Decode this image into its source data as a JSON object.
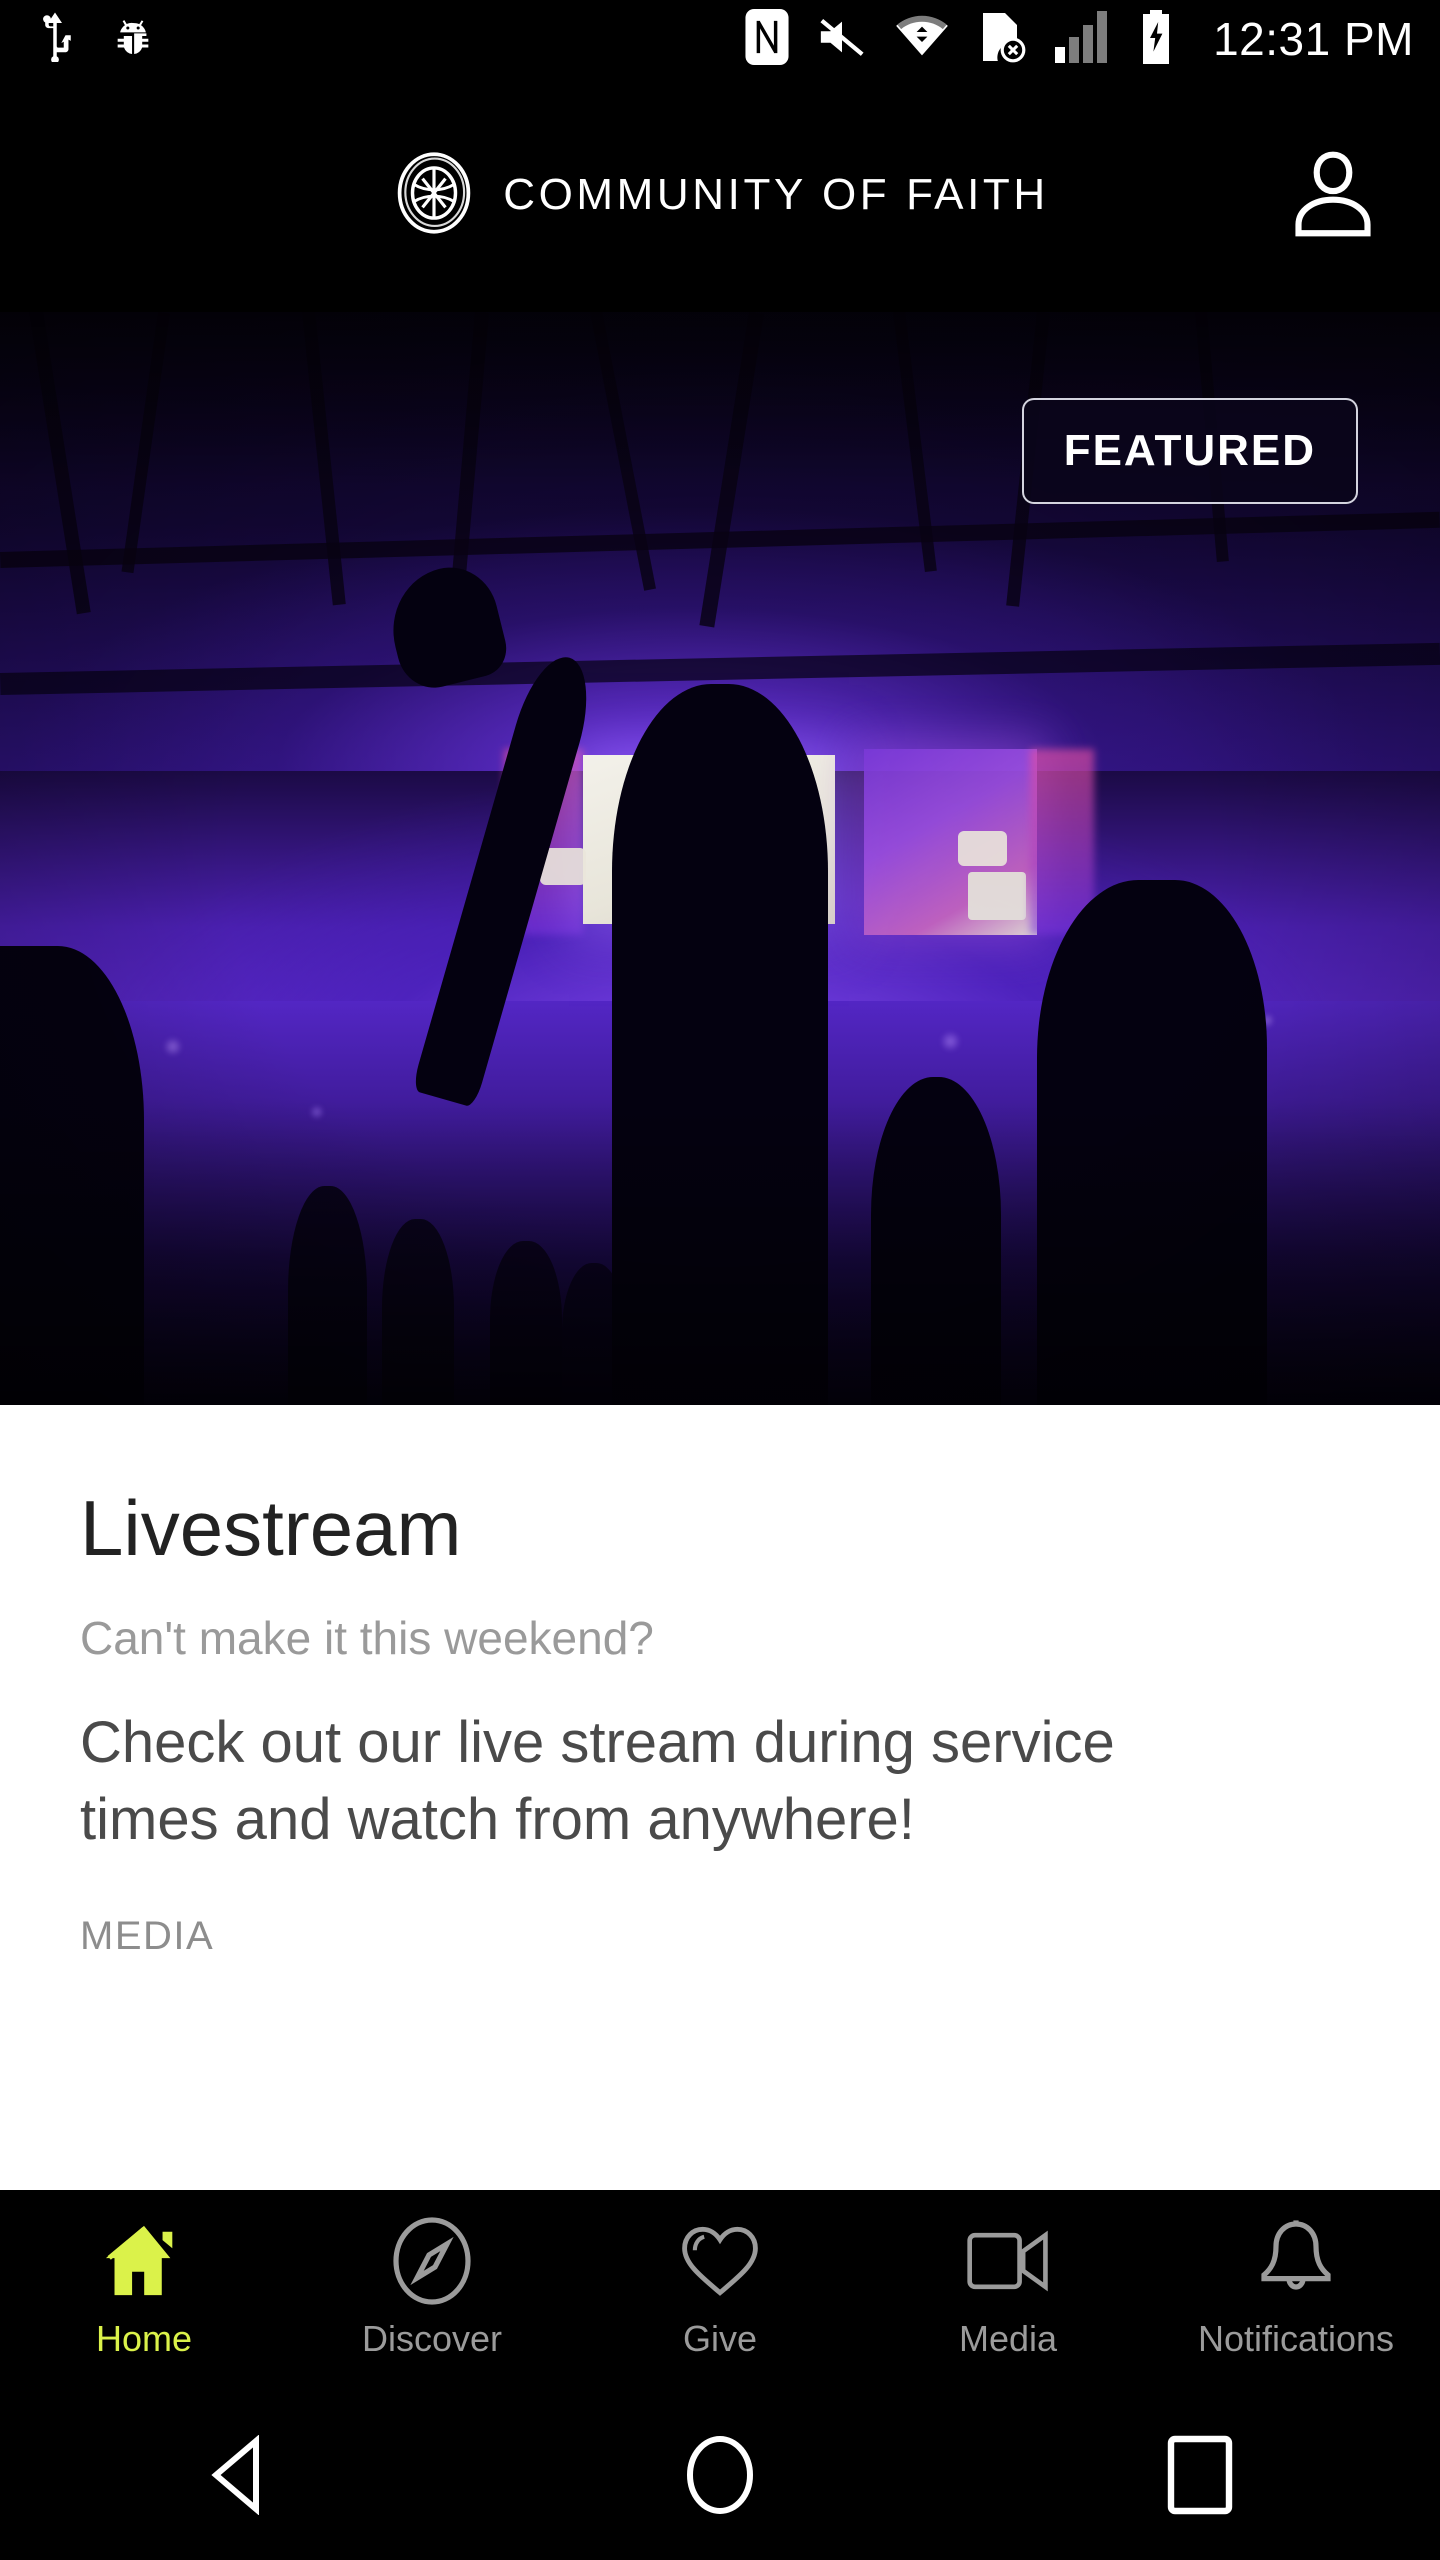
{
  "status_bar": {
    "left_icons": [
      {
        "name": "usb-icon",
        "label": "USB connected"
      },
      {
        "name": "android-debug-icon",
        "label": "USB debugging"
      }
    ],
    "right_icons": [
      {
        "name": "nfc-icon",
        "label": "NFC"
      },
      {
        "name": "volume-mute-icon",
        "label": "Sound off"
      },
      {
        "name": "wifi-icon",
        "label": "Wi-Fi"
      },
      {
        "name": "no-sim-icon",
        "label": "No SIM"
      },
      {
        "name": "signal-bars-icon",
        "label": "Cellular signal"
      },
      {
        "name": "battery-charging-icon",
        "label": "Battery charging"
      }
    ],
    "time": "12:31 PM"
  },
  "header": {
    "logo_name": "globe-cross-logo",
    "title": "COMMUNITY OF FAITH",
    "profile_icon": "person-icon"
  },
  "hero": {
    "badge": "FEATURED",
    "image_description": "Worship service auditorium with purple stage lighting, video screens and silhouetted crowd with raised hand"
  },
  "card": {
    "title": "Livestream",
    "subtitle": "Can't make it this weekend?",
    "body": "Check out our live stream during service times and watch from anywhere!",
    "category": "MEDIA"
  },
  "bottom_nav": {
    "active_color": "#dbf24a",
    "inactive_color": "#9b9b9b",
    "items": [
      {
        "label": "Home",
        "icon": "home-icon",
        "active": true
      },
      {
        "label": "Discover",
        "icon": "compass-icon",
        "active": false
      },
      {
        "label": "Give",
        "icon": "heart-icon",
        "active": false
      },
      {
        "label": "Media",
        "icon": "video-camera-icon",
        "active": false
      },
      {
        "label": "Notifications",
        "icon": "bell-icon",
        "active": false
      }
    ]
  },
  "system_nav": {
    "back": "back-triangle-icon",
    "home": "home-circle-icon",
    "recents": "recents-square-icon"
  }
}
